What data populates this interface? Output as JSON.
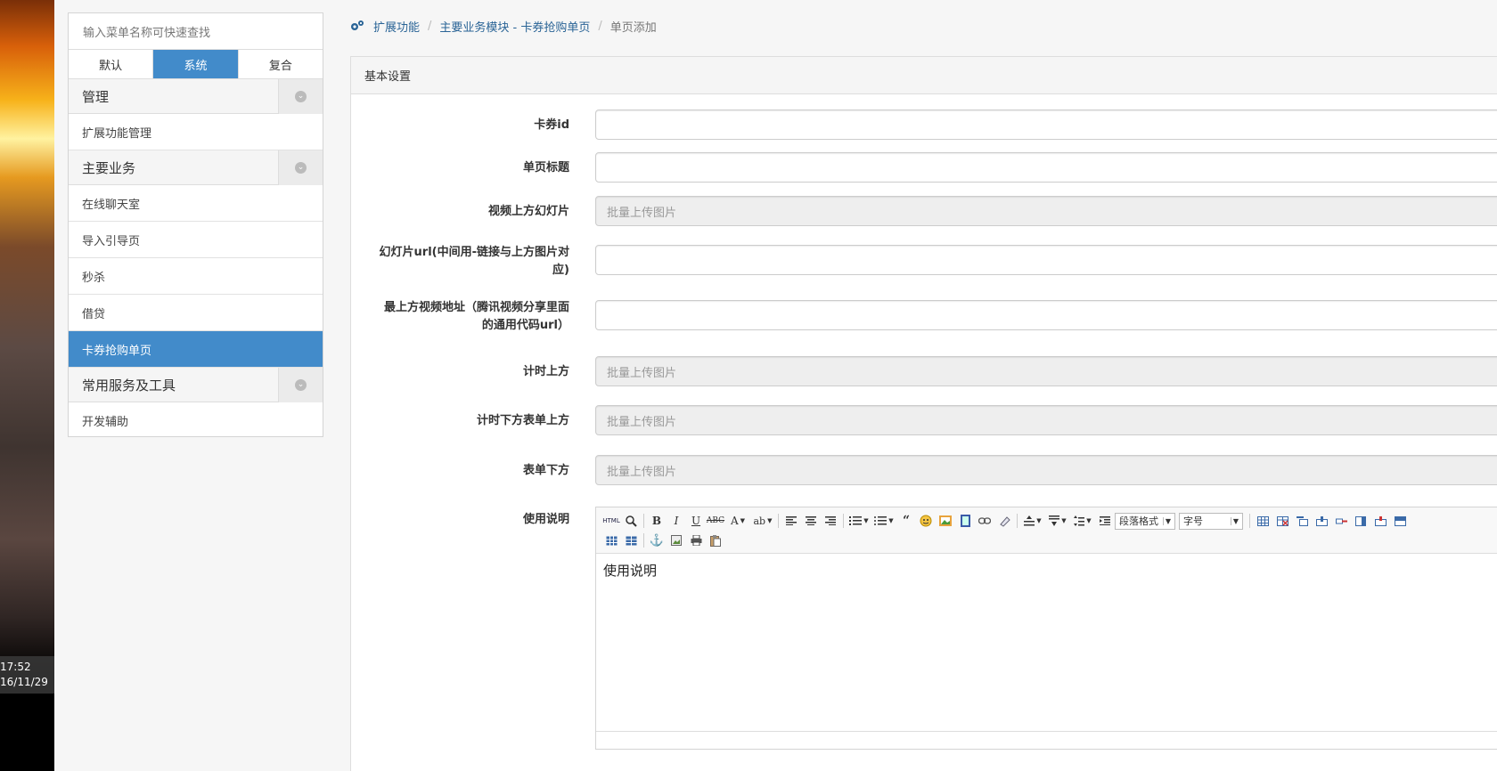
{
  "desktop": {
    "clock_time": "17:52",
    "clock_date": "16/11/29"
  },
  "sidebar": {
    "search_placeholder": "输入菜单名称可快速查找",
    "mode_tabs": [
      "默认",
      "系统",
      "复合"
    ],
    "groups": [
      {
        "label": "管理",
        "items": [
          "扩展功能管理"
        ]
      },
      {
        "label": "主要业务",
        "items": [
          "在线聊天室",
          "导入引导页",
          "秒杀",
          "借贷",
          "卡券抢购单页"
        ]
      },
      {
        "label": "常用服务及工具",
        "items": [
          "开发辅助"
        ]
      }
    ],
    "active_item": "卡券抢购单页",
    "active_tab": "系统"
  },
  "breadcrumb": {
    "items": [
      "扩展功能",
      "主要业务模块 - 卡券抢购单页",
      "单页添加"
    ],
    "separator": "/"
  },
  "panel": {
    "heading": "基本设置",
    "fields": [
      {
        "label": "卡券id",
        "value": ""
      },
      {
        "label": "单页标题",
        "value": ""
      },
      {
        "label": "视频上方幻灯片",
        "placeholder": "批量上传图片"
      },
      {
        "label_line1": "幻灯片url(中间用-链接与上方图片对",
        "label_line2": "应)",
        "value": ""
      },
      {
        "label_line1": "最上方视频地址（腾讯视频分享里面",
        "label_line2": "的通用代码url）",
        "value": ""
      },
      {
        "label": "计时上方",
        "placeholder": "批量上传图片"
      },
      {
        "label": "计时下方表单上方",
        "placeholder": "批量上传图片"
      },
      {
        "label": "表单下方",
        "placeholder": "批量上传图片"
      }
    ],
    "editor": {
      "label": "使用说明",
      "content": "使用说明",
      "html_btn": "HTML",
      "paragraph_select": "段落格式",
      "fontsize_select": "字号"
    }
  },
  "colors": {
    "accent": "#428bca",
    "link": "#2a6496"
  }
}
